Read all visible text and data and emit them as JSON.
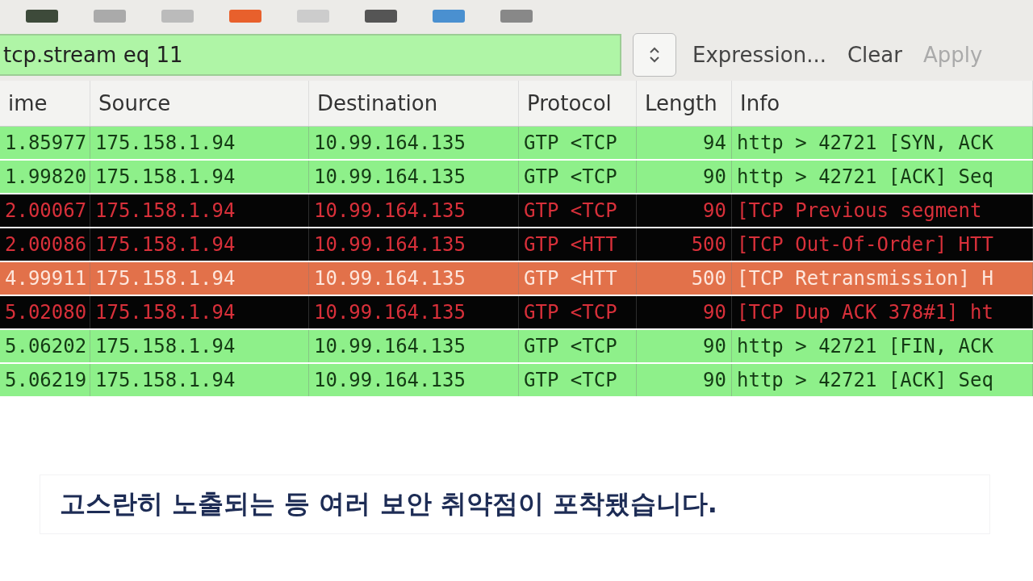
{
  "filter": {
    "value": "tcp.stream eq 11",
    "valid": true
  },
  "filter_buttons": [
    {
      "label": "Expression...",
      "disabled": false
    },
    {
      "label": "Clear",
      "disabled": false
    },
    {
      "label": "Apply",
      "disabled": true
    }
  ],
  "table": {
    "columns": [
      "ime",
      "Source",
      "Destination",
      "Protocol",
      "Length",
      "Info"
    ],
    "rows": [
      {
        "kind": "ok",
        "selected": false,
        "cells": [
          "1.85977",
          "175.158.1.94",
          "10.99.164.135",
          "GTP <TCP",
          "94",
          "http > 42721 [SYN, ACK"
        ]
      },
      {
        "kind": "ok",
        "selected": false,
        "cells": [
          "1.99820",
          "175.158.1.94",
          "10.99.164.135",
          "GTP <TCP",
          "90",
          "http > 42721 [ACK] Seq"
        ]
      },
      {
        "kind": "error",
        "selected": false,
        "cells": [
          "2.00067",
          "175.158.1.94",
          "10.99.164.135",
          "GTP <TCP",
          "90",
          "[TCP Previous segment"
        ]
      },
      {
        "kind": "error",
        "selected": false,
        "cells": [
          "2.00086",
          "175.158.1.94",
          "10.99.164.135",
          "GTP <HTT",
          "500",
          "[TCP Out-Of-Order] HTT"
        ]
      },
      {
        "kind": "error",
        "selected": true,
        "cells": [
          "4.99911",
          "175.158.1.94",
          "10.99.164.135",
          "GTP <HTT",
          "500",
          "[TCP Retransmission] H"
        ]
      },
      {
        "kind": "error",
        "selected": false,
        "cells": [
          "5.02080",
          "175.158.1.94",
          "10.99.164.135",
          "GTP <TCP",
          "90",
          "[TCP Dup ACK 378#1] ht"
        ]
      },
      {
        "kind": "ok",
        "selected": false,
        "cells": [
          "5.06202",
          "175.158.1.94",
          "10.99.164.135",
          "GTP <TCP",
          "90",
          "http > 42721 [FIN, ACK"
        ]
      },
      {
        "kind": "ok",
        "selected": false,
        "cells": [
          "5.06219",
          "175.158.1.94",
          "10.99.164.135",
          "GTP <TCP",
          "90",
          "http > 42721 [ACK] Seq"
        ]
      }
    ]
  },
  "caption": "고스란히 노출되는 등 여러 보안 취약점이 포착됐습니다."
}
